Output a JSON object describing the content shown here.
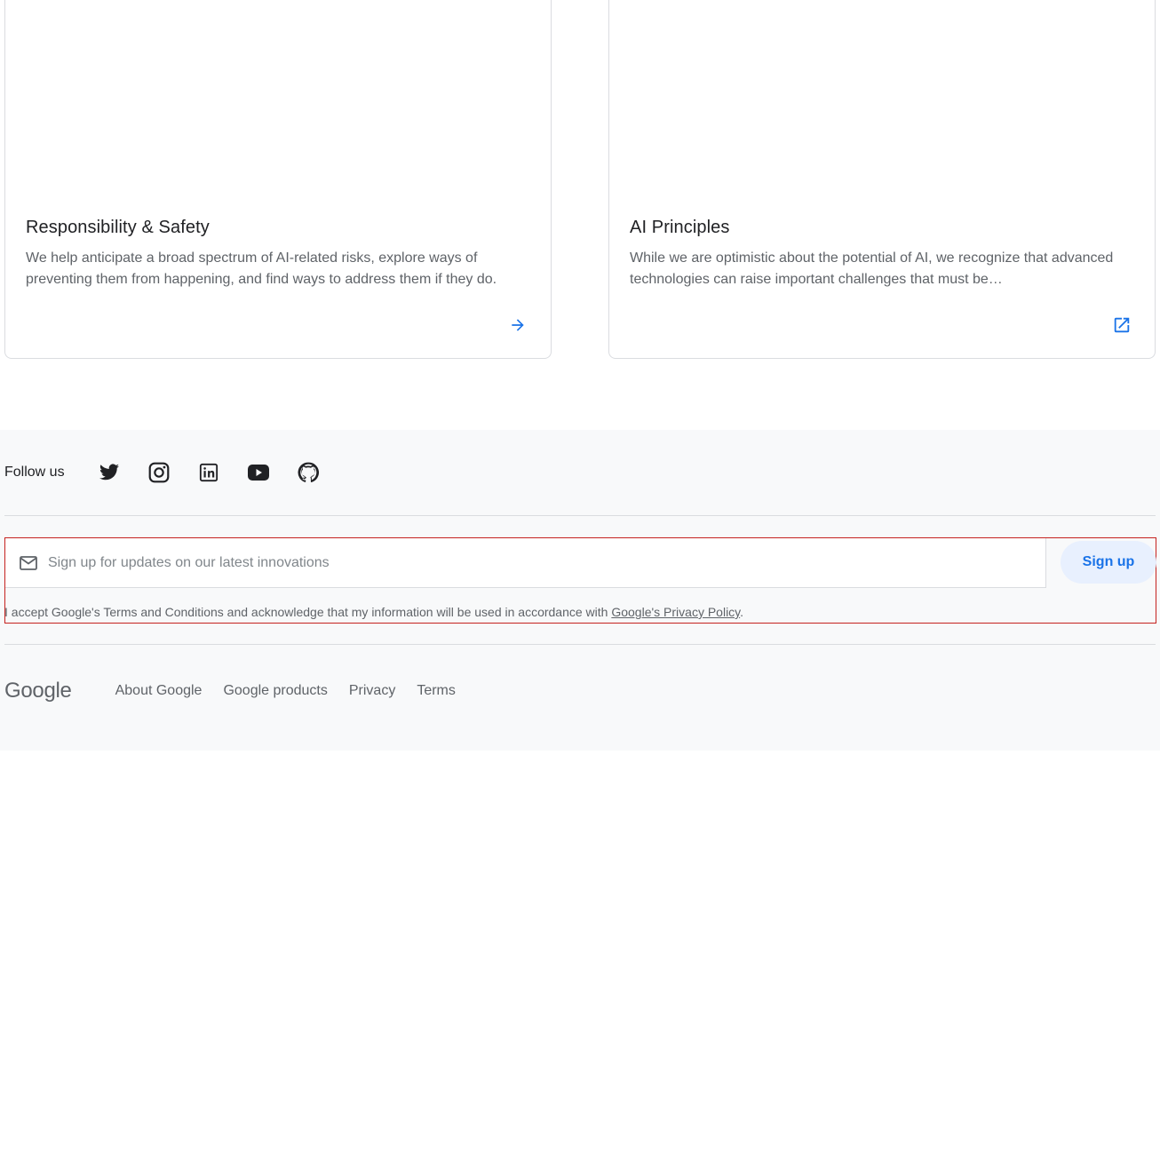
{
  "cards": [
    {
      "title": "Responsibility & Safety",
      "description": "We help anticipate a broad spectrum of AI-related risks, explore ways of preventing them from happening, and find ways to address them if they do.",
      "action_icon": "arrow-right-icon"
    },
    {
      "title": "AI Principles",
      "description": "While we are optimistic about the potential of AI, we recognize that advanced technologies can raise important challenges that must be…",
      "action_icon": "external-link-icon"
    }
  ],
  "footer": {
    "follow_label": "Follow us",
    "social_icons": [
      "twitter-icon",
      "instagram-icon",
      "linkedin-icon",
      "youtube-icon",
      "github-icon"
    ],
    "signup": {
      "placeholder": "Sign up for updates on our latest innovations",
      "button_label": "Sign up",
      "consent_text": "I accept Google's Terms and Conditions and acknowledge that my information will be used in accordance with ",
      "privacy_link": "Google's Privacy Policy",
      "consent_end": "."
    },
    "logo_text": "Google",
    "links": [
      "About Google",
      "Google products",
      "Privacy",
      "Terms"
    ]
  },
  "colors": {
    "accent": "#1a73e8",
    "footer_bg": "#f8f9fa",
    "highlight_border": "#c5221f"
  }
}
